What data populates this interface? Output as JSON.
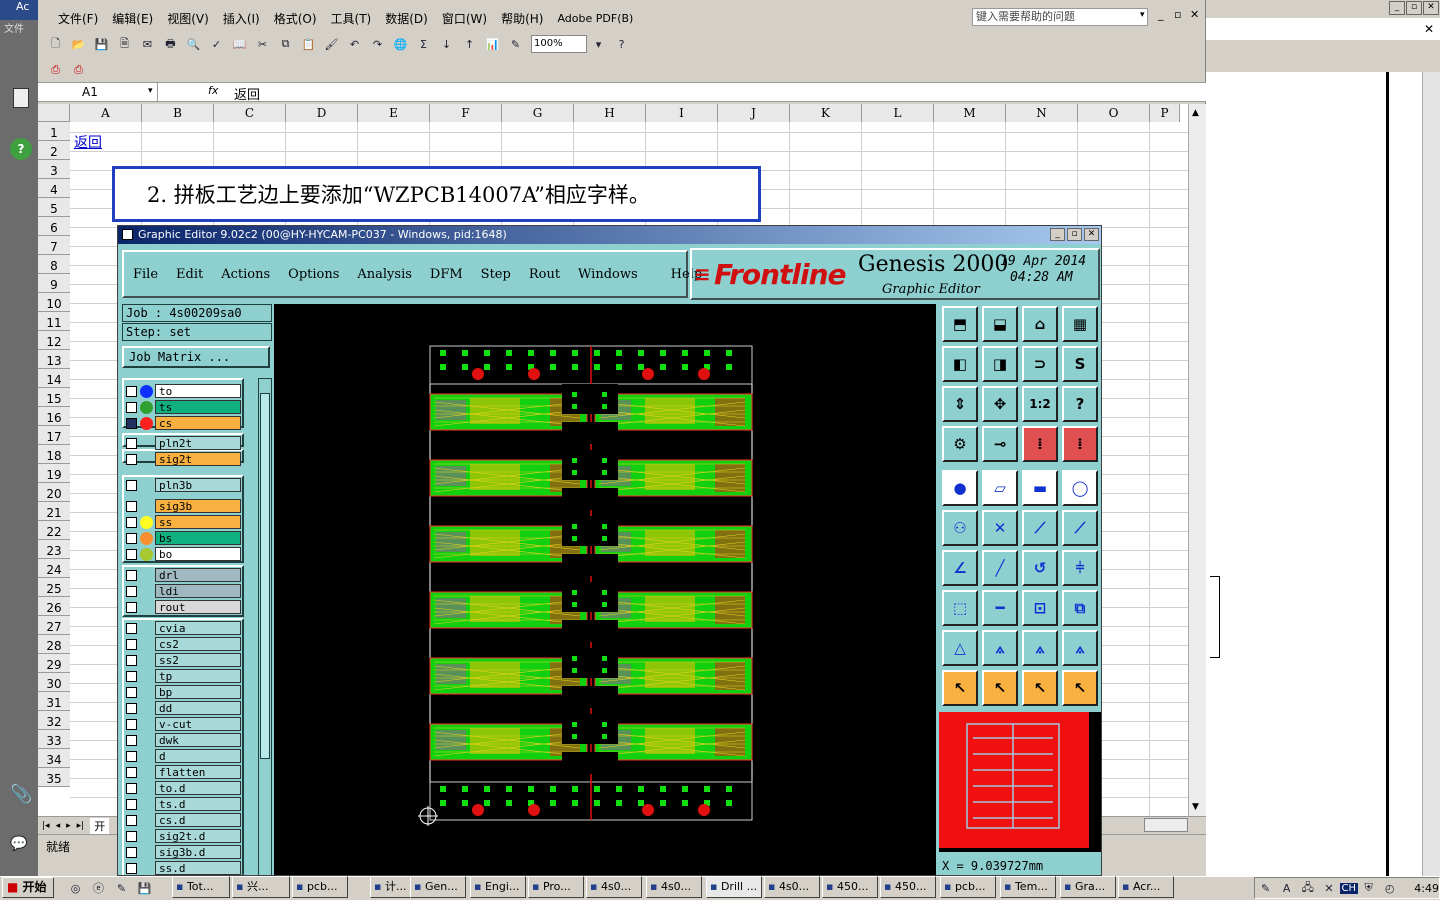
{
  "excel": {
    "title_partial": "Ac",
    "side_label": "文件",
    "menu": [
      "文件(F)",
      "编辑(E)",
      "视图(V)",
      "插入(I)",
      "格式(O)",
      "工具(T)",
      "数据(D)",
      "窗口(W)",
      "帮助(H)",
      "Adobe PDF(B)"
    ],
    "help_placeholder": "键入需要帮助的问题",
    "zoom": "100%",
    "name_box": "A1",
    "fx": "fx",
    "formula": "返回",
    "columns": [
      "A",
      "B",
      "C",
      "D",
      "E",
      "F",
      "G",
      "H",
      "I",
      "J",
      "K",
      "L",
      "M",
      "N",
      "O",
      "P"
    ],
    "rows": [
      "1",
      "2",
      "3",
      "4",
      "5",
      "6",
      "7",
      "8",
      "9",
      "10",
      "11",
      "12",
      "13",
      "14",
      "15",
      "16",
      "17",
      "18",
      "19",
      "20",
      "21",
      "22",
      "23",
      "24",
      "25",
      "26",
      "27",
      "28",
      "29",
      "30",
      "31",
      "32",
      "33",
      "34",
      "35"
    ],
    "a1_link": "返回",
    "sheet_tab": "开",
    "status": "就绪",
    "note": "2. 拼板工艺边上要添加“WZPCB14007A”相应字样。"
  },
  "genesis": {
    "window_title": "Graphic Editor 9.02c2 (00@HY-HYCAM-PC037 - Windows, pid:1648)",
    "menu": [
      "File",
      "Edit",
      "Actions",
      "Options",
      "Analysis",
      "DFM",
      "Step",
      "Rout",
      "Windows",
      "Help"
    ],
    "brand": "Frontline",
    "product": "Genesis 2000",
    "subtitle": "Graphic Editor",
    "date": "19 Apr 2014",
    "time": "04:28 AM",
    "job": "Job : 4s00209sa0",
    "step": "Step: set",
    "job_matrix": "Job Matrix ...",
    "coord": "X = 9.039727mm",
    "layers": [
      {
        "name": "to",
        "dot": "#1030ff",
        "bg": "#ffffff"
      },
      {
        "name": "ts",
        "dot": "#30a030",
        "bg": "#10b080"
      },
      {
        "name": "cs",
        "dot": "#ff2020",
        "bg": "#f8b040"
      },
      {
        "name": "pln2t",
        "dot": "",
        "bg": "#a8d8d8"
      },
      {
        "name": "sig2t",
        "dot": "",
        "bg": "#f8b040"
      },
      {
        "name": "pln3b",
        "dot": "",
        "bg": "#a8d8d8"
      },
      {
        "name": "sig3b",
        "dot": "",
        "bg": "#f8b040"
      },
      {
        "name": "ss",
        "dot": "#ffff20",
        "bg": "#f8b040"
      },
      {
        "name": "bs",
        "dot": "#f89030",
        "bg": "#10b080"
      },
      {
        "name": "bo",
        "dot": "#a8c830",
        "bg": "#ffffff"
      },
      {
        "name": "drl",
        "dot": "",
        "bg": "#a0b8c0"
      },
      {
        "name": "ldi",
        "dot": "",
        "bg": "#a0b8c0"
      },
      {
        "name": "rout",
        "dot": "",
        "bg": "#d8d8d8"
      },
      {
        "name": "cvia",
        "dot": "",
        "bg": "#a8d8d8"
      },
      {
        "name": "cs2",
        "dot": "",
        "bg": "#a8d8d8"
      },
      {
        "name": "ss2",
        "dot": "",
        "bg": "#a8d8d8"
      },
      {
        "name": "tp",
        "dot": "",
        "bg": "#a8d8d8"
      },
      {
        "name": "bp",
        "dot": "",
        "bg": "#a8d8d8"
      },
      {
        "name": "dd",
        "dot": "",
        "bg": "#a8d8d8"
      },
      {
        "name": "v-cut",
        "dot": "",
        "bg": "#a8d8d8"
      },
      {
        "name": "dwk",
        "dot": "",
        "bg": "#a8d8d8"
      },
      {
        "name": "d",
        "dot": "",
        "bg": "#a8d8d8"
      },
      {
        "name": "flatten",
        "dot": "",
        "bg": "#a8d8d8"
      },
      {
        "name": "to.d",
        "dot": "",
        "bg": "#a8d8d8"
      },
      {
        "name": "ts.d",
        "dot": "",
        "bg": "#a8d8d8"
      },
      {
        "name": "cs.d",
        "dot": "",
        "bg": "#a8d8d8"
      },
      {
        "name": "sig2t.d",
        "dot": "",
        "bg": "#a8d8d8"
      },
      {
        "name": "sig3b.d",
        "dot": "",
        "bg": "#a8d8d8"
      },
      {
        "name": "ss.d",
        "dot": "",
        "bg": "#a8d8d8"
      }
    ],
    "tool_ratio": "1:2"
  },
  "taskbar": {
    "start": "开始",
    "items": [
      "Tot...",
      "兴...",
      "pcb...",
      "计...",
      "Gen...",
      "Engi...",
      "Pro...",
      "4s0...",
      "4s0...",
      "Drill ...",
      "4s0...",
      "450...",
      "450...",
      "pcb...",
      "Tem...",
      "Gra...",
      "Acr..."
    ],
    "tray_lang": "CH",
    "clock": "4:49"
  },
  "colors": {
    "accent": "#0a246a",
    "genesis_bg": "#8ed0d0",
    "pcb_green": "#10e010",
    "pcb_red": "#e01010"
  }
}
